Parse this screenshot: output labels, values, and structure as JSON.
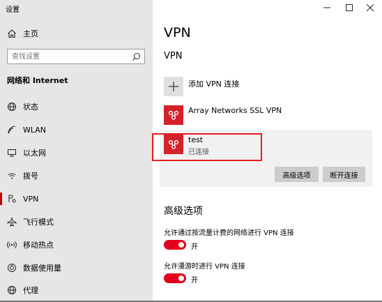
{
  "window": {
    "title": "设置",
    "controls": [
      "minimize-icon",
      "maximize-icon",
      "close-icon"
    ]
  },
  "sidebar": {
    "home": {
      "label": "主页",
      "icon": "home-icon"
    },
    "search": {
      "placeholder": "查找设置",
      "value": "",
      "icon": "search-icon"
    },
    "section_title": "网络和 Internet",
    "items": [
      {
        "label": "状态",
        "icon": "globe-icon",
        "active": false
      },
      {
        "label": "WLAN",
        "icon": "wifi-icon",
        "active": false
      },
      {
        "label": "以太网",
        "icon": "ethernet-icon",
        "active": false
      },
      {
        "label": "拨号",
        "icon": "dialup-icon",
        "active": false
      },
      {
        "label": "VPN",
        "icon": "vpn-icon",
        "active": true
      },
      {
        "label": "飞行模式",
        "icon": "airplane-icon",
        "active": false
      },
      {
        "label": "移动热点",
        "icon": "hotspot-icon",
        "active": false
      },
      {
        "label": "数据使用量",
        "icon": "data-usage-icon",
        "active": false
      },
      {
        "label": "代理",
        "icon": "proxy-icon",
        "active": false
      }
    ]
  },
  "main": {
    "page_title": "VPN",
    "section_title": "VPN",
    "add_connection": {
      "label": "添加 VPN 连接",
      "icon": "plus-icon"
    },
    "connections": [
      {
        "name": "Array Networks SSL VPN",
        "status": "",
        "icon": "array-networks-logo-icon"
      },
      {
        "name": "test",
        "status": "已连接",
        "icon": "array-networks-logo-icon"
      }
    ],
    "buttons": {
      "advanced": "高级选项",
      "disconnect": "断开连接"
    },
    "advanced": {
      "title": "高级选项",
      "options": [
        {
          "label": "允许通过按流量计费的网络进行 VPN 连接",
          "state": "开",
          "on": true
        },
        {
          "label": "允许漫游时进行 VPN 连接",
          "state": "开",
          "on": true
        }
      ]
    }
  },
  "colors": {
    "sidebar_bg": "#e6e6e6",
    "accent_red": "#e3001b",
    "logo_red": "#d3222a",
    "highlight_border": "#e61e1e",
    "button_bg": "#cccccc",
    "expanded_bg": "#f1f1f1"
  }
}
